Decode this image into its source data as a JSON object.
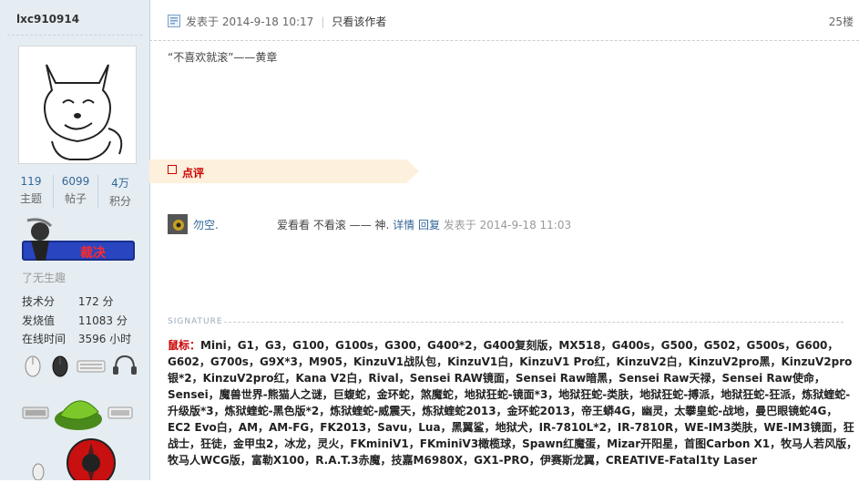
{
  "sidebar": {
    "username": "lxc910914",
    "stats": [
      {
        "value": "119",
        "label": "主题"
      },
      {
        "value": "6099",
        "label": "帖子"
      },
      {
        "value": "4万",
        "label": "积分"
      }
    ],
    "medal_text": "裁决",
    "status": "了无生趣",
    "props": [
      {
        "key": "技术分",
        "value": "172 分"
      },
      {
        "key": "发烧值",
        "value": "11083 分"
      },
      {
        "key": "在线时间",
        "value": "3596 小时"
      }
    ]
  },
  "post": {
    "posted_label": "发表于 2014-9-18 10:17",
    "only_author": "只看该作者",
    "floor": "25楼",
    "content": "“不喜欢就滚”——黄章",
    "comment_label": "点评"
  },
  "reply": {
    "name": "勿空.",
    "text": "爱看看 不看滚 —— 神.",
    "detail": "详情",
    "reply_link": "回复",
    "when": "发表于 2014-9-18 11:03"
  },
  "signature": {
    "title": "SIGNATURE",
    "lead": "鼠标：",
    "body": "Mini，G1，G3，G100，G100s，G300，G400*2，G400复刻版，MX518，G400s，G500，G502，G500s，G600，G602，G700s，G9X*3，M905，KinzuV1战队包，KinzuV1白，KinzuV1 Pro红，KinzuV2白，KinzuV2pro黑，KinzuV2pro银*2，KinzuV2pro红，Kana V2白，Rival，Sensei RAW镜面，Sensei Raw暗黑，Sensei Raw天禄，Sensei Raw使命，Sensei，魔兽世界-熊猫人之谜，巨蝮蛇，金环蛇，煞魔蛇，地狱狂蛇-镜面*3，地狱狂蛇-类肤，地狱狂蛇-搏派，地狱狂蛇-狂派，炼狱蝰蛇-升级版*3，炼狱蝰蛇-黑色版*2，炼狱蝰蛇-威震天，炼狱蝰蛇2013，金环蛇2013，帝王蟒4G，幽灵，太攀皇蛇-战地，曼巴眼镜蛇4G，EC2 Evo白，AM，AM-FG，FK2013，Savu，Lua，黑翼鲨，地狱犬，IR-7810L*2，IR-7810R，WE-IM3类肤，WE-IM3镜面，狂战士，狂徒，金甲虫2，冰龙，灵火，FKminiV1，FKminiV3橄榄球，Spawn红魔蛋，Mizar开阳星，首图Carbon X1，牧马人若风版，牧马人WCG版，富勒X100，R.A.T.3赤魔，技嘉M6980X，GX1-PRO，伊赛斯龙翼，CREATIVE-Fatal1ty Laser"
  }
}
